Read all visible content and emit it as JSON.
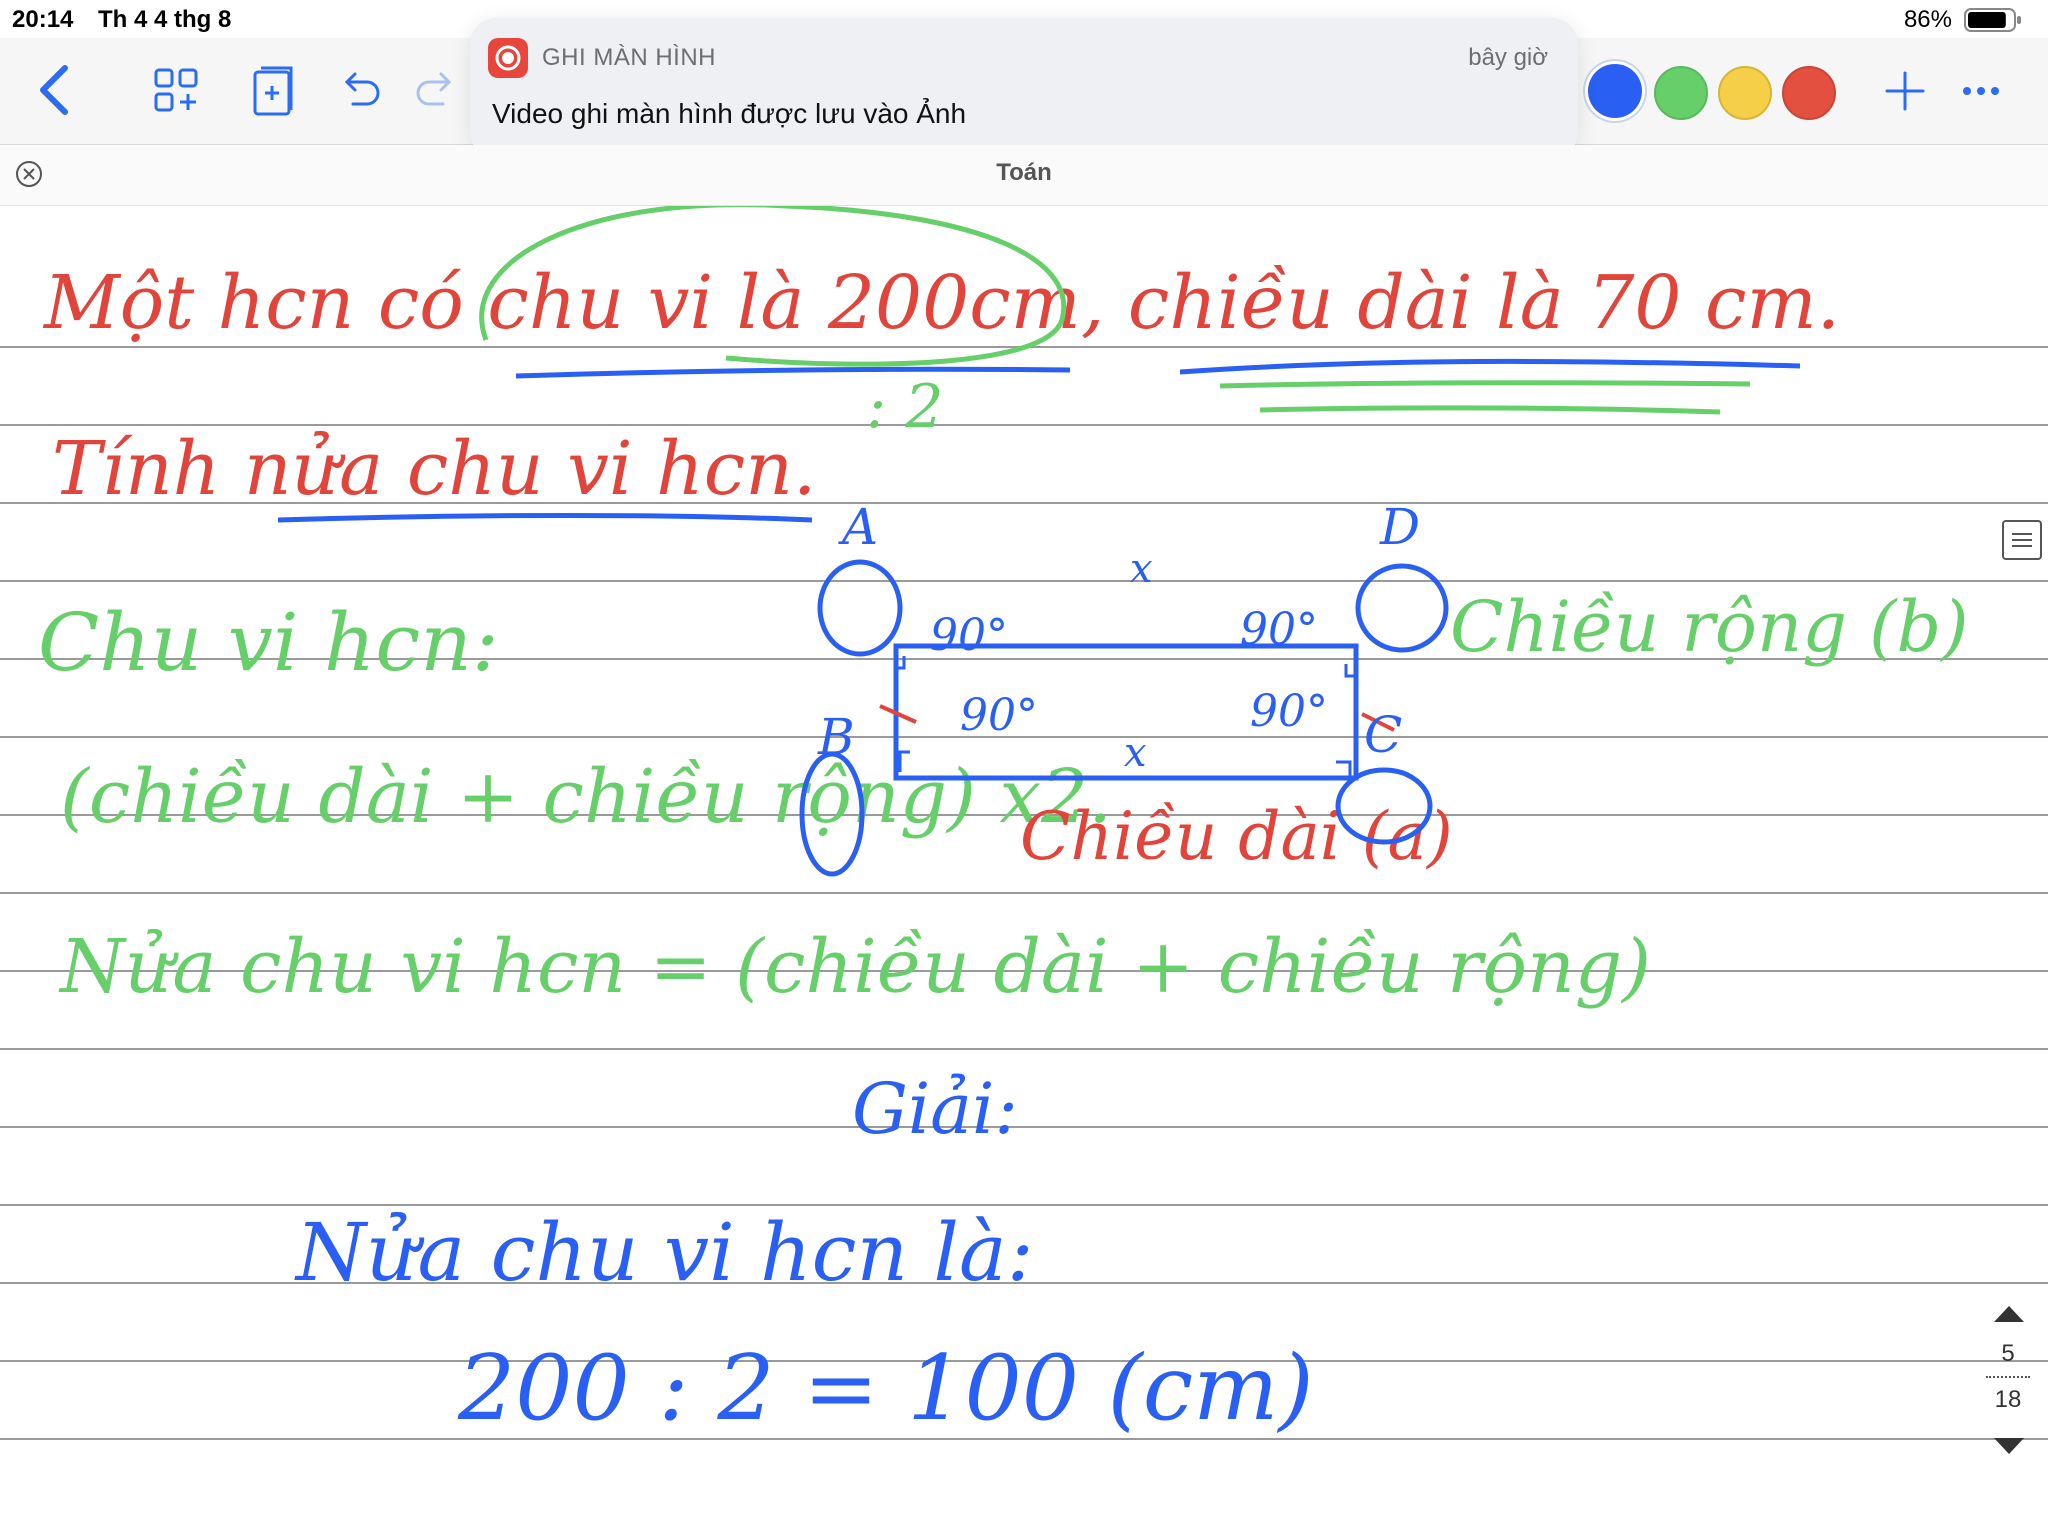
{
  "status_bar": {
    "time": "20:14",
    "date": "Th 4 4 thg 8",
    "battery": "86%",
    "battery_level": 0.86
  },
  "toolbar": {
    "back_icon": "chevron-left-icon",
    "buttons": [
      "grid-add-icon",
      "page-add-icon",
      "undo-icon",
      "redo-icon",
      "plus-icon",
      "more-icon"
    ],
    "colors": [
      "#2a5ff3",
      "#66cf6a",
      "#f4cf47",
      "#e3503f"
    ],
    "selected_color": "#2a5ff3"
  },
  "notification": {
    "app": "GHI MÀN HÌNH",
    "time": "bây giờ",
    "message": "Video ghi màn hình được lưu vào Ảnh",
    "icon": "screen-record-icon"
  },
  "document": {
    "title": "Toán"
  },
  "notes": {
    "line1": "Một hcn có chu vi là 200cm, chiều dài là 70 cm.",
    "line1_mark": ": 2",
    "line2": "Tính nửa chu vi hcn.",
    "perimeter_label": "Chu vi hcn:",
    "perimeter_formula": "(chiều dài + chiều rộng) x2.",
    "half_perimeter_formula": "Nửa chu vi hcn = (chiều dài + chiều rộng)",
    "width_label": "Chiều rộng (b)",
    "length_label": "Chiều dài (a)",
    "solution_heading": "Giải:",
    "solution_line": "Nửa chu vi hcn là:",
    "calc": "200 : 2 = 100 (cm)"
  },
  "diagram": {
    "vertices": [
      "A",
      "D",
      "B",
      "C"
    ],
    "angles": [
      "90°",
      "90°",
      "90°",
      "90°"
    ],
    "side_marks": [
      "x",
      "x"
    ]
  },
  "pager": {
    "current": "5",
    "total": "18"
  }
}
